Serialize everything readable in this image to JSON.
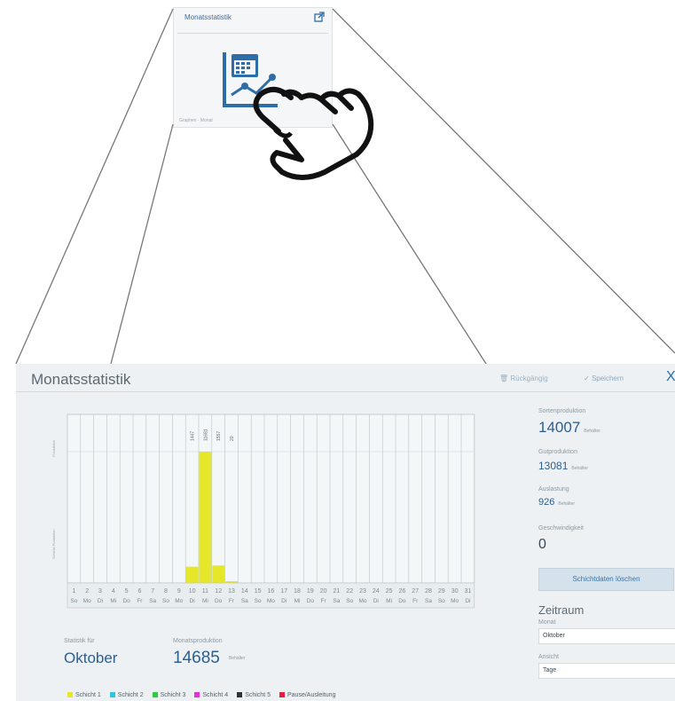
{
  "tile": {
    "title": "Monatsstatistik",
    "footer": "Graphen · Monat"
  },
  "screen": {
    "title": "Monatsstatistik",
    "undo_label": "Rückgängig",
    "save_label": "Speichern",
    "close_symbol": "X",
    "y_labels": [
      "Produktion",
      "Schicht-Produktion"
    ],
    "stat_for_label": "Statistik für",
    "stat_month": "Oktober",
    "monthly_label": "Monatsproduktion",
    "monthly_value": "14685",
    "monthly_unit": "Behälter"
  },
  "side": {
    "sorten_label": "Sortenproduktion",
    "sorten_value": "14007",
    "sorten_unit": "Behälter",
    "gut_label": "Gutproduktion",
    "gut_value": "13081",
    "gut_unit": "Behälter",
    "ausl_label": "Auslastung",
    "ausl_value": "926",
    "ausl_unit": "Behälter",
    "speed_label": "Geschwindigkeit",
    "speed_value": "0",
    "clear_button": "Schichtdaten löschen",
    "zeitraum_heading": "Zeitraum",
    "monat_label": "Monat",
    "monat_value": "Oktober",
    "ansicht_label": "Ansicht",
    "ansicht_value": "Tage"
  },
  "legend": [
    {
      "label": "Schicht 1",
      "color": "#e6e62a"
    },
    {
      "label": "Schicht 2",
      "color": "#2ec6e6"
    },
    {
      "label": "Schicht 3",
      "color": "#2ecc40"
    },
    {
      "label": "Schicht 4",
      "color": "#e62ee0"
    },
    {
      "label": "Schicht 5",
      "color": "#333333"
    },
    {
      "label": "Pause/Ausleitung",
      "color": "#e61e3c"
    }
  ],
  "chart_data": {
    "type": "bar",
    "categories": [
      "1",
      "2",
      "3",
      "4",
      "5",
      "6",
      "7",
      "8",
      "9",
      "10",
      "11",
      "12",
      "13",
      "14",
      "15",
      "16",
      "17",
      "18",
      "19",
      "20",
      "21",
      "22",
      "23",
      "24",
      "25",
      "26",
      "27",
      "28",
      "29",
      "30",
      "31"
    ],
    "weekdays": [
      "So",
      "Mo",
      "Di",
      "Mi",
      "Do",
      "Fr",
      "Sa",
      "So",
      "Mo",
      "Di",
      "Mi",
      "Do",
      "Fr",
      "Sa",
      "So",
      "Mo",
      "Di",
      "Mi",
      "Do",
      "Fr",
      "Sa",
      "So",
      "Mo",
      "Di",
      "Mi",
      "Do",
      "Fr",
      "Sa",
      "So",
      "Mo",
      "Di"
    ],
    "series": [
      {
        "name": "Schicht 1",
        "color": "#e6e62a",
        "values": [
          0,
          0,
          0,
          0,
          0,
          0,
          0,
          0,
          0,
          1447,
          11681,
          1557,
          20,
          0,
          0,
          0,
          0,
          0,
          0,
          0,
          0,
          0,
          0,
          0,
          0,
          0,
          0,
          0,
          0,
          0,
          0
        ]
      }
    ],
    "data_labels": [
      "",
      "",
      "",
      "",
      "",
      "",
      "",
      "",
      "",
      "1447",
      "11681",
      "1557",
      "20",
      "",
      "",
      "",
      "",
      "",
      "",
      "",
      "",
      "",
      "",
      "",
      "",
      "",
      "",
      "",
      "",
      "",
      ""
    ],
    "ylim": [
      0,
      11681
    ],
    "grid": true
  }
}
